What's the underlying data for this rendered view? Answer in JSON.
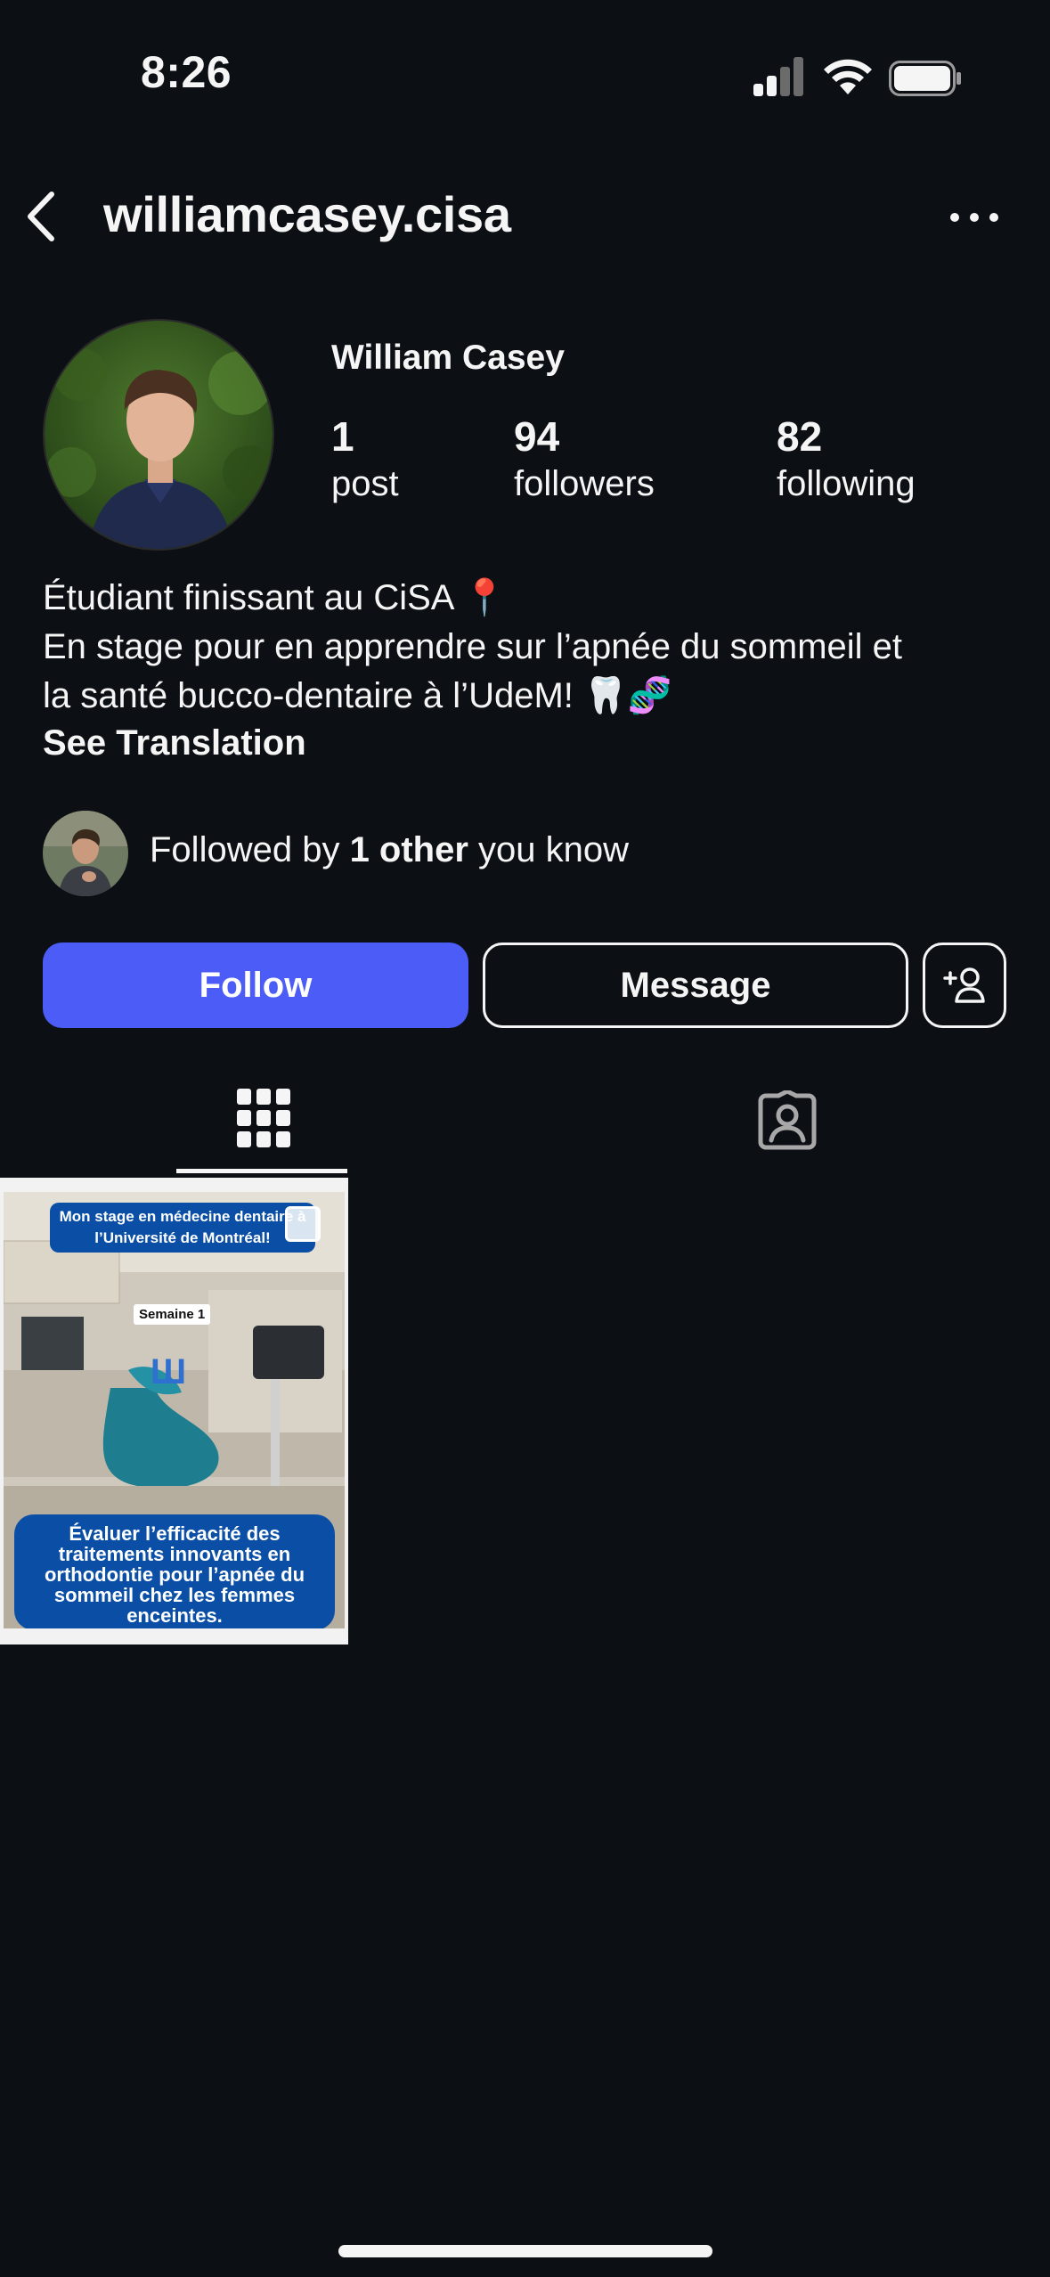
{
  "status_bar": {
    "time": "8:26"
  },
  "header": {
    "username": "williamcasey.cisa"
  },
  "profile": {
    "full_name": "William Casey",
    "stats": [
      {
        "value": "1",
        "label": "post"
      },
      {
        "value": "94",
        "label": "followers"
      },
      {
        "value": "82",
        "label": "following"
      }
    ],
    "bio_lines": [
      "Étudiant finissant au CiSA 📍",
      "En stage pour en apprendre sur l’apnée du sommeil et",
      "la santé bucco-dentaire à l’UdeM! 🦷🧬"
    ],
    "see_translation": "See Translation",
    "followed_by": {
      "prefix": "Followed by ",
      "bold": "1 other",
      "suffix": " you know"
    }
  },
  "actions": {
    "follow": "Follow",
    "message": "Message"
  },
  "tabs": [
    {
      "icon": "grid-icon",
      "active": true
    },
    {
      "icon": "tagged-person-icon",
      "active": false
    }
  ],
  "posts": [
    {
      "title": "Mon stage en médecine dentaire à l’Université de Montréal!",
      "week": "Semaine 1",
      "caption": "Évaluer l’efficacité des traitements innovants en orthodontie pour l’apnée du sommeil chez les femmes enceintes."
    }
  ],
  "colors": {
    "background": "#0c1014",
    "follow_button": "#4c5cf7",
    "post_accent": "#0a4fa5"
  }
}
